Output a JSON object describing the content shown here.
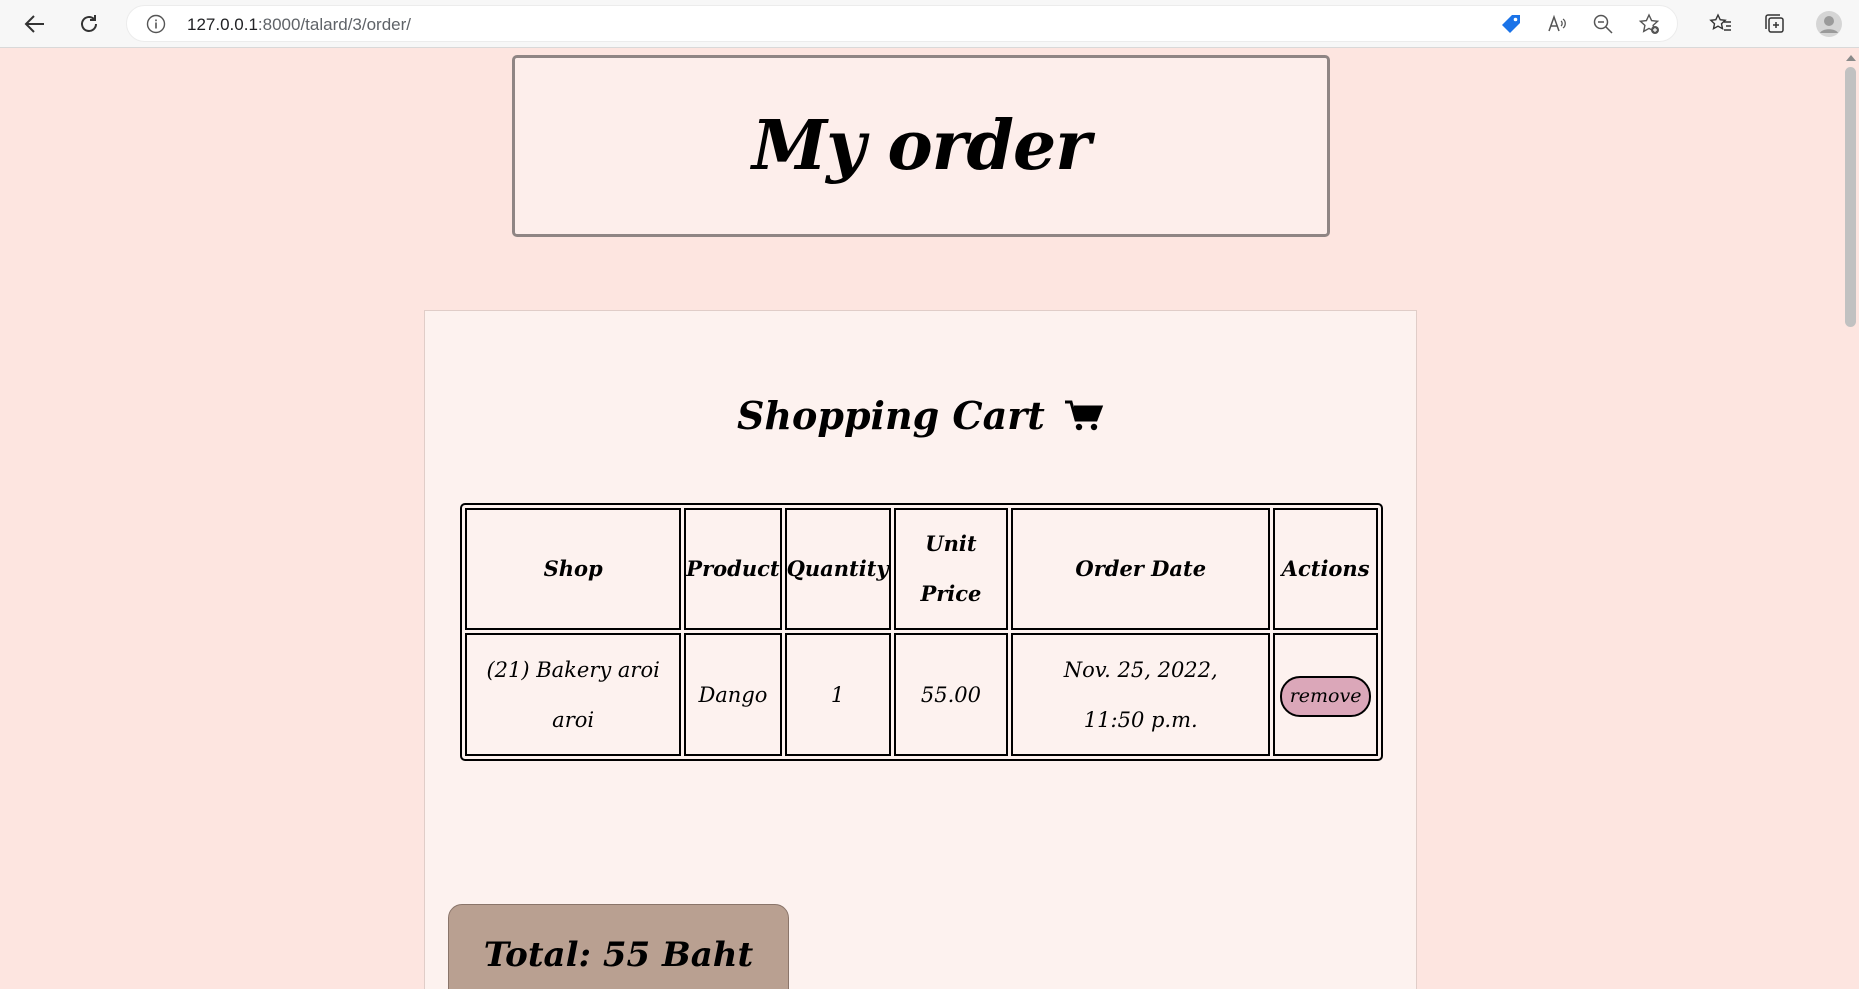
{
  "browser": {
    "url_host": "127.0.0.1",
    "url_path": ":8000/talard/3/order/"
  },
  "header": {
    "title": "My order"
  },
  "cart": {
    "title": "Shopping Cart",
    "columns": [
      "Shop",
      "Product",
      "Quantity",
      "Unit Price",
      "Order Date",
      "Actions"
    ],
    "rows": [
      {
        "shop": "(21) Bakery aroi aroi",
        "product": "Dango",
        "quantity": "1",
        "unit_price": "55.00",
        "order_date": "Nov. 25, 2022, 11:50 p.m.",
        "action_label": "remove"
      }
    ],
    "total": "Total: 55 Baht"
  },
  "colors": {
    "page_bg": "#fde5e0",
    "card_bg": "#fdf2ef",
    "remove_button": "#dba7b9",
    "total_box": "#b9a091"
  }
}
